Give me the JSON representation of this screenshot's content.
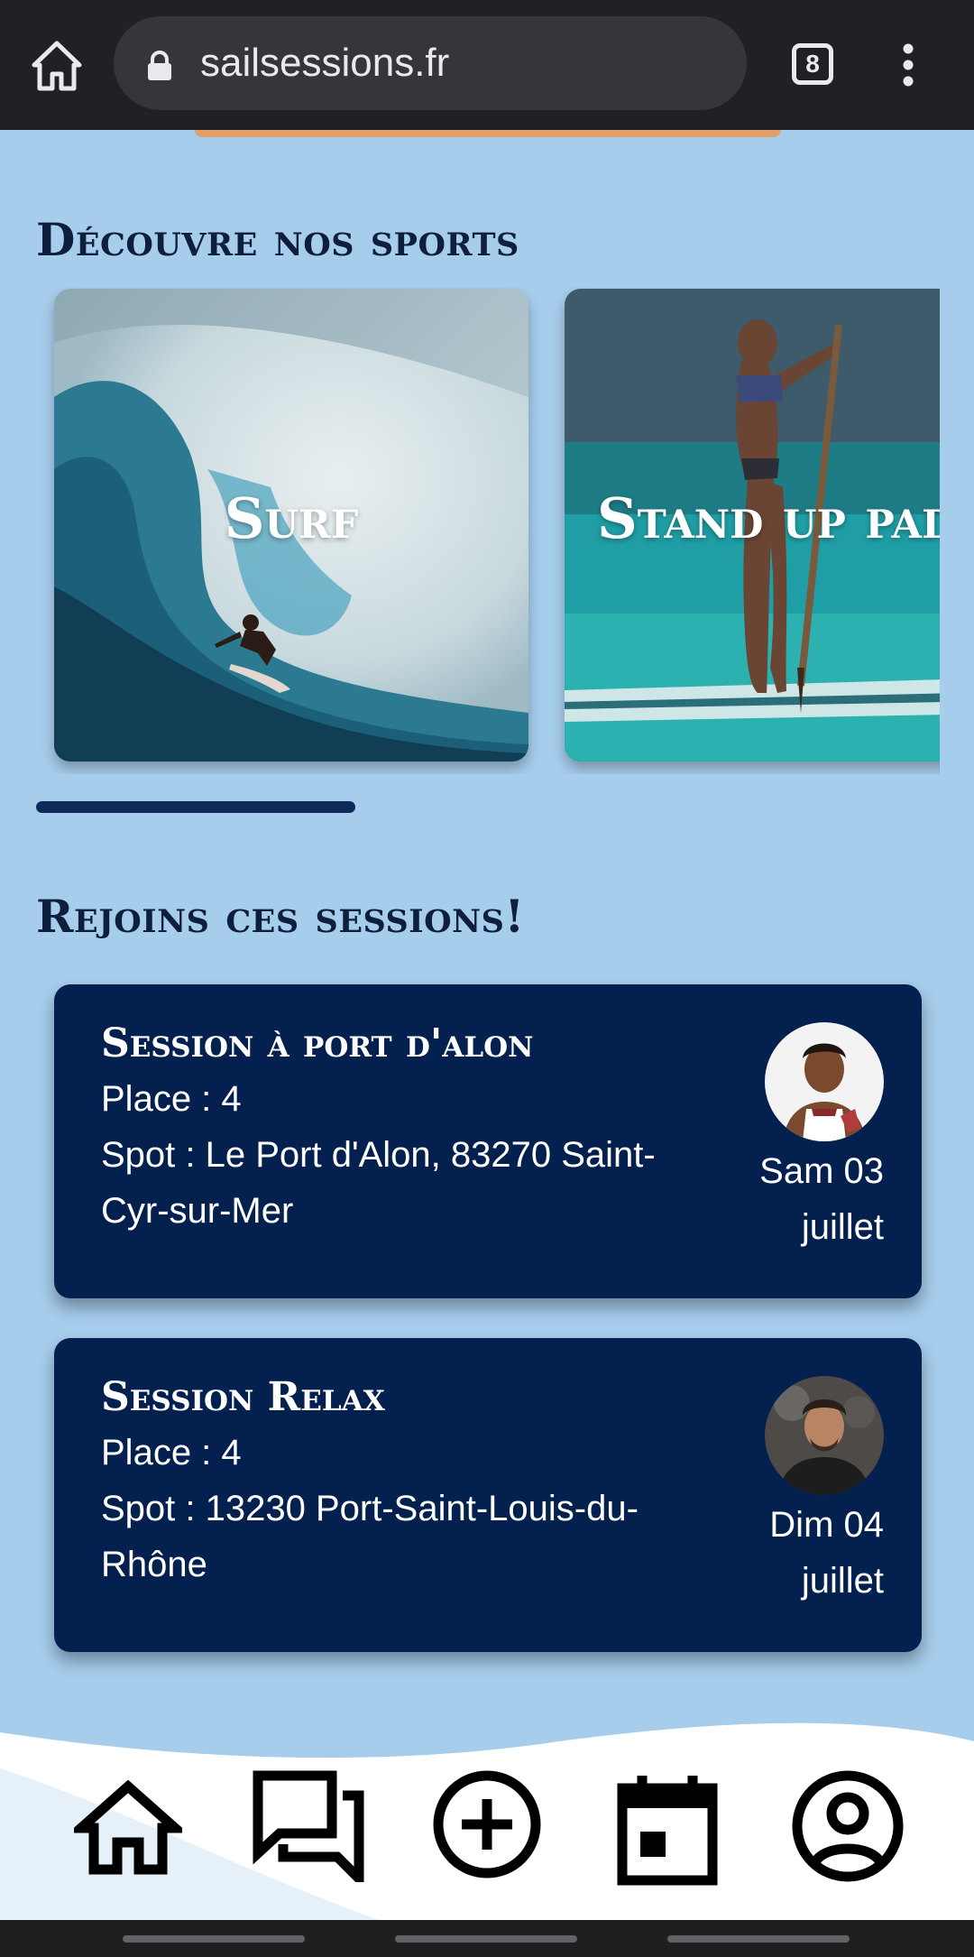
{
  "browser": {
    "url": "sailsessions.fr",
    "tab_count": "8"
  },
  "sports": {
    "title": "Découvre nos sports",
    "cards": [
      {
        "label": "Surf"
      },
      {
        "label": "Stand up paddle"
      }
    ],
    "scroll_progress": 0.33
  },
  "sessions": {
    "title": "Rejoins ces sessions!",
    "items": [
      {
        "title": "Session à port d'alon",
        "place": "Place : 4",
        "spot": "Spot : Le Port d'Alon, 83270 Saint-Cyr-sur-Mer",
        "date_line1": "Sam 03",
        "date_line2": "juillet"
      },
      {
        "title": "Session Relax",
        "place": "Place : 4",
        "spot": "Spot : 13230 Port-Saint-Louis-du-Rhône",
        "date_line1": "Dim 04",
        "date_line2": "juillet"
      }
    ]
  },
  "nav": {
    "items": [
      "home-icon",
      "chat-icon",
      "add-circle-icon",
      "calendar-icon",
      "account-icon"
    ]
  }
}
